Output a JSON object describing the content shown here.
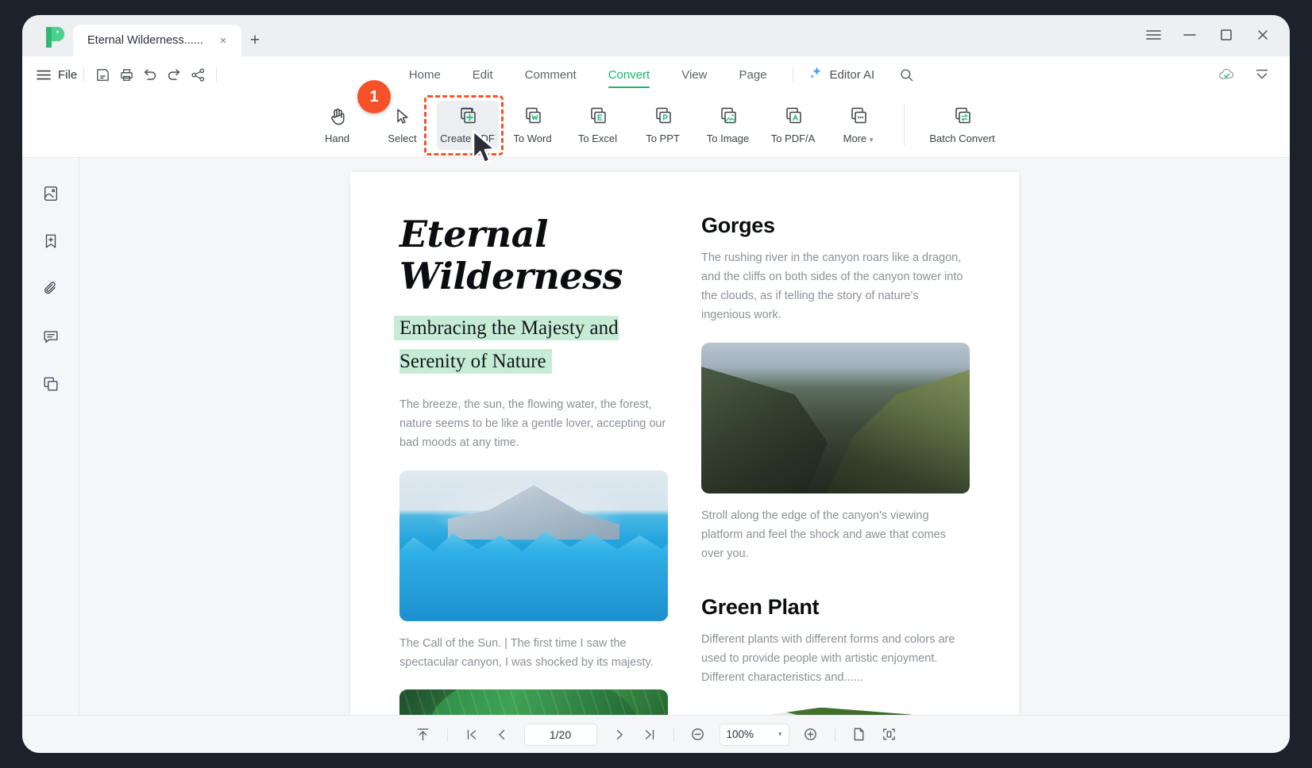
{
  "window": {
    "tab_title": "Eternal Wilderness......",
    "close_tab_label": "×",
    "new_tab_label": "+",
    "menu_label": "☰",
    "minimize_label": "—",
    "maximize_label": "□",
    "close_label": "✕"
  },
  "menu": {
    "file_label": "File",
    "icons": [
      {
        "name": "save-icon"
      },
      {
        "name": "print-icon"
      },
      {
        "name": "undo-icon"
      },
      {
        "name": "redo-icon"
      },
      {
        "name": "share-icon"
      }
    ]
  },
  "ribbon_tabs": [
    {
      "label": "Home",
      "active": false
    },
    {
      "label": "Edit",
      "active": false
    },
    {
      "label": "Comment",
      "active": false
    },
    {
      "label": "Convert",
      "active": true
    },
    {
      "label": "View",
      "active": false
    },
    {
      "label": "Page",
      "active": false
    }
  ],
  "editor_ai": {
    "label": "Editor AI",
    "icon": "sparkle-icon"
  },
  "search": {
    "icon": "search-icon"
  },
  "menu_right": {
    "cloud_status_icon": "cloud-check-icon",
    "collapse_icon": "collapse-ribbon-icon"
  },
  "ribbon_buttons": [
    {
      "label": "Hand",
      "icon": "hand-icon",
      "highlighted": false
    },
    {
      "label": "Select",
      "icon": "cursor-select-icon",
      "highlighted": false
    },
    {
      "label": "Create PDF",
      "icon": "create-pdf-icon",
      "highlighted": true
    },
    {
      "label": "To Word",
      "icon": "to-word-icon",
      "highlighted": false
    },
    {
      "label": "To Excel",
      "icon": "to-excel-icon",
      "highlighted": false
    },
    {
      "label": "To PPT",
      "icon": "to-ppt-icon",
      "highlighted": false
    },
    {
      "label": "To Image",
      "icon": "to-image-icon",
      "highlighted": false
    },
    {
      "label": "To PDF/A",
      "icon": "to-pdfa-icon",
      "highlighted": false
    },
    {
      "label": "More",
      "icon": "more-icon",
      "highlighted": false,
      "has_caret": true
    },
    {
      "label": "Batch Convert",
      "icon": "batch-convert-icon",
      "highlighted": false
    }
  ],
  "step_badge": {
    "number": "1"
  },
  "left_rail": [
    {
      "name": "thumbnails-icon"
    },
    {
      "name": "bookmarks-icon"
    },
    {
      "name": "attachments-icon"
    },
    {
      "name": "comments-icon"
    },
    {
      "name": "layers-icon"
    }
  ],
  "document": {
    "title_line1": "Eternal",
    "title_line2": "Wilderness",
    "subtitle": "Embracing the Majesty and Serenity of Nature",
    "intro": "The breeze, the sun, the flowing water, the forest, nature seems to be like a gentle lover, accepting our bad moods at any time.",
    "glacier_caption": "The Call of the Sun. | The first time I saw the spectacular canyon, I was shocked by its majesty.",
    "section_gorges": {
      "heading": "Gorges",
      "paragraph": "The rushing river in the canyon roars like a dragon, and the cliffs on both sides of the canyon tower into the clouds, as if telling the story of nature's ingenious work.",
      "caption": "Stroll along the edge of the canyon's viewing platform and feel the shock and awe that comes over you."
    },
    "section_green_plant": {
      "heading": "Green Plant",
      "paragraph": "Different plants with different forms and colors are used to provide people with artistic enjoyment. Different characteristics and......"
    }
  },
  "statusbar": {
    "upload_icon": "scroll-to-top-icon",
    "first_page_icon": "first-page-icon",
    "prev_page_icon": "prev-page-icon",
    "page_value": "1/20",
    "next_page_icon": "next-page-icon",
    "last_page_icon": "last-page-icon",
    "zoom_out_icon": "zoom-out-icon",
    "zoom_value": "100%",
    "zoom_caret": "▾",
    "zoom_in_icon": "zoom-in-icon",
    "single_page_icon": "single-page-view-icon",
    "fit_page_icon": "fit-page-icon"
  },
  "colors": {
    "accent_green": "#14b866",
    "highlight_orange": "#f5522a",
    "subtitle_highlight": "#c6ecd6",
    "window_bg": "#edeff2",
    "viewer_bg": "#f4f6f8"
  }
}
